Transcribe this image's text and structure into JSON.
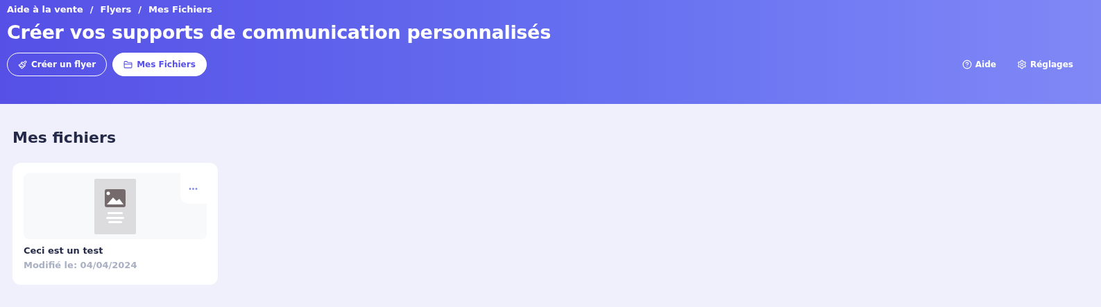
{
  "breadcrumb": [
    "Aide à la vente",
    "Flyers",
    "Mes Fichiers"
  ],
  "breadcrumb_separator": "/",
  "title": "Créer vos supports de communication personnalisés",
  "nav_buttons": [
    {
      "label": "Créer un flyer",
      "kind": "brush",
      "selected": false
    },
    {
      "label": "Mes Fichiers",
      "kind": "folder",
      "selected": true
    }
  ],
  "header_links": [
    {
      "label": "Aide",
      "kind": "help"
    },
    {
      "label": "Réglages",
      "kind": "settings"
    }
  ],
  "section_title": "Mes fichiers",
  "files": [
    {
      "name": "Ceci est un test",
      "modified": "Modifié le: 04/04/2024",
      "menu": "•••"
    }
  ]
}
